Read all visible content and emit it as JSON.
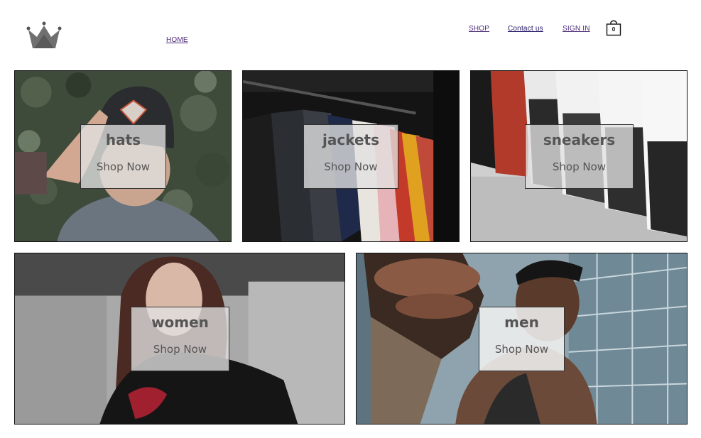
{
  "header": {
    "logo_icon": "crown-icon",
    "nav": {
      "home": "HOME",
      "shop": "SHOP",
      "contact": "Contact us",
      "sign_in": "SIGN IN"
    },
    "cart": {
      "icon": "shopping-bag-icon",
      "count": "0"
    }
  },
  "categories": [
    {
      "title": "hats",
      "cta": "Shop Now"
    },
    {
      "title": "jackets",
      "cta": "Shop Now"
    },
    {
      "title": "sneakers",
      "cta": "Shop Now"
    },
    {
      "title": "women",
      "cta": "Shop Now"
    },
    {
      "title": "men",
      "cta": "Shop Now"
    }
  ],
  "colors": {
    "link": "#4b2a78",
    "overlay": "#e1e1e1",
    "title_text": "#555555",
    "border": "#111111"
  }
}
